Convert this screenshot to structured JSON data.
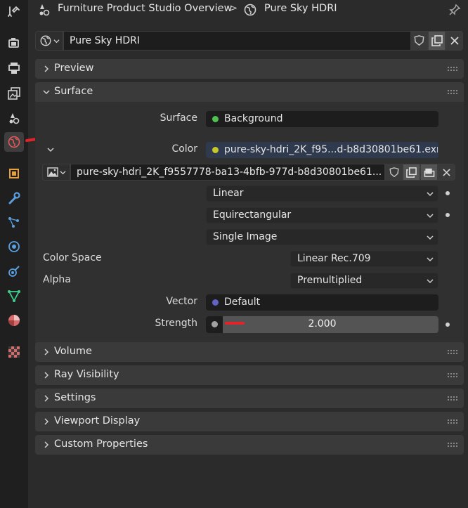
{
  "header": {
    "scene_name": "Furniture Product Studio Overview",
    "separator": ">",
    "world_name": "Pure Sky HDRI"
  },
  "world_selector": {
    "name": "Pure Sky HDRI"
  },
  "panels": {
    "preview": "Preview",
    "surface": "Surface",
    "volume": "Volume",
    "ray_visibility": "Ray Visibility",
    "settings": "Settings",
    "viewport_display": "Viewport Display",
    "custom_properties": "Custom Properties"
  },
  "surface": {
    "surface_label": "Surface",
    "surface_value": "Background",
    "color_label": "Color",
    "color_value": "pure-sky-hdri_2K_f95...d-b8d30801be61.exr",
    "image_name": "pure-sky-hdri_2K_f9557778-ba13-4bfb-977d-b8d30801be61...",
    "interpolation": "Linear",
    "projection": "Equirectangular",
    "source": "Single Image",
    "color_space_label": "Color Space",
    "color_space_value": "Linear Rec.709",
    "alpha_label": "Alpha",
    "alpha_value": "Premultiplied",
    "vector_label": "Vector",
    "vector_value": "Default",
    "strength_label": "Strength",
    "strength_value": "2.000"
  },
  "colors": {
    "socket_shader": "#4fc14f",
    "socket_color": "#c7c729",
    "socket_vector": "#6363c7",
    "socket_float": "#a1a1a1",
    "annotation_red": "#e0242a",
    "active_tab": "#3d3d3d"
  },
  "icons": [
    "tool-icon",
    "render-icon",
    "output-icon",
    "view-layer-icon",
    "scene-icon",
    "world-icon",
    "object-icon",
    "modifier-icon",
    "particles-icon",
    "physics-icon",
    "constraints-icon",
    "data-icon",
    "material-icon",
    "texture-icon"
  ]
}
